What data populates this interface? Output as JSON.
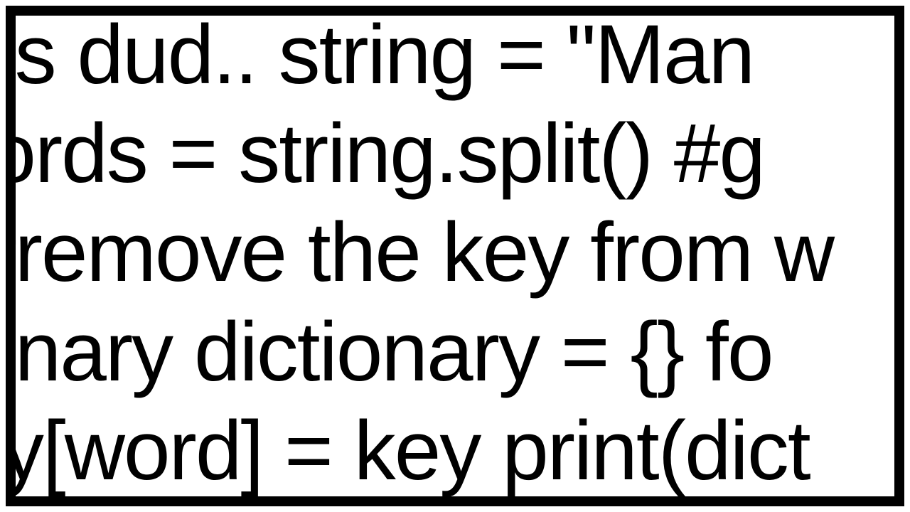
{
  "code_box": {
    "lines": [
      " this dud.. string = \"Man ",
      " words = string.split() #g",
      "l #remove the key from w",
      "tionary dictionary = {} fo",
      "ary[word] = key print(dict"
    ]
  }
}
